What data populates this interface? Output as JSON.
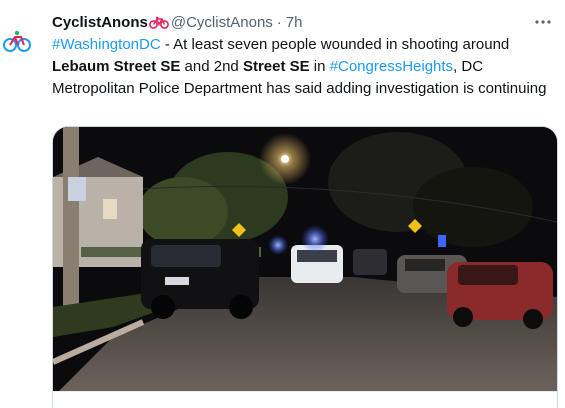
{
  "tweet": {
    "display_name": "CyclistAnons",
    "name_emoji": "bicycle-emoji",
    "handle": "@CyclistAnons",
    "separator": "·",
    "time": "7h",
    "more_icon": "more-horizontal-icon",
    "text": {
      "hashtag_1": "#WashingtonDC",
      "part_1": " - At least seven people wounded in shooting around ",
      "bold_1": "Lebaum Street SE",
      "part_2": " and 2nd ",
      "bold_2": "Street SE",
      "part_3": " in ",
      "hashtag_2": "#CongressHeights",
      "part_4": ", DC Metropolitan Police Department has said adding investigation is continuing"
    }
  },
  "avatar": {
    "icon": "cyclist-logo-icon"
  },
  "media": {
    "description_icon": "night-street-photo"
  },
  "colors": {
    "link": "#1d9bf0",
    "text": "#0f1419",
    "secondary": "#536471",
    "border": "#cfd9de"
  }
}
